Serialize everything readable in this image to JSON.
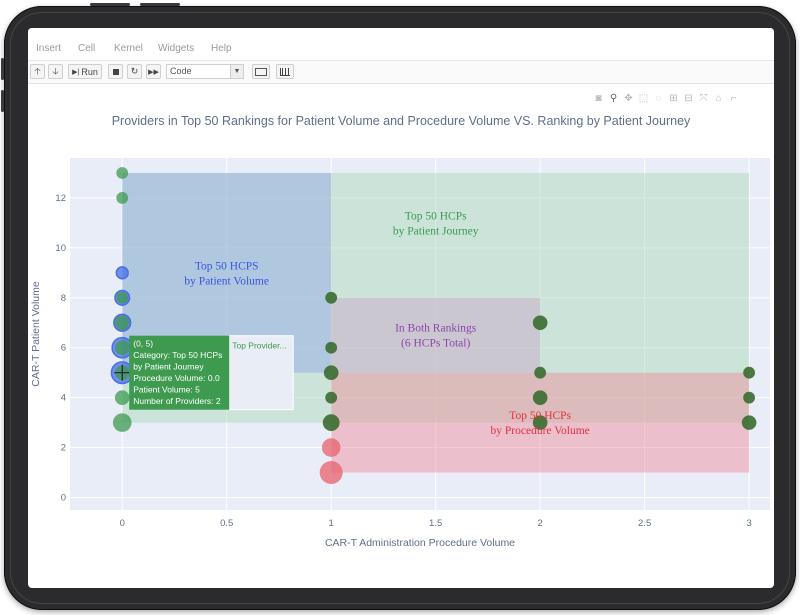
{
  "menu": {
    "items": [
      "Insert",
      "Cell",
      "Kernel",
      "Widgets",
      "Help"
    ]
  },
  "toolbar": {
    "run_label": "Run",
    "cell_type": "Code"
  },
  "modebar": {
    "icons": [
      "camera-icon",
      "zoom-icon",
      "pan-icon",
      "box-select-icon",
      "lasso-icon",
      "zoom-in-icon",
      "zoom-out-icon",
      "autoscale-icon",
      "home-icon",
      "spike-icon"
    ]
  },
  "colors": {
    "plot_bg": "#e8edf7",
    "patient_volume": "#4a6de6",
    "patient_journey": "#3d9a4f",
    "procedure_volume": "#e8606e",
    "both": "#8e44ad",
    "both_marker": "#3a6b30"
  },
  "chart_data": {
    "type": "scatter",
    "title": "Providers in Top 50 Rankings for Patient Volume and Procedure Volume VS. Ranking by Patient Journey",
    "xlabel": "CAR-T Administration Procedure Volume",
    "ylabel": "CAR-T Patient Volume",
    "xlim": [
      -0.25,
      3.1
    ],
    "ylim": [
      -0.5,
      13.6
    ],
    "xticks": [
      0,
      0.5,
      1,
      1.5,
      2,
      2.5,
      3
    ],
    "xtick_labels": [
      "0",
      "0.5",
      "1",
      "1.5",
      "2",
      "2.5",
      "3"
    ],
    "yticks": [
      0,
      2,
      4,
      6,
      8,
      10,
      12
    ],
    "ytick_labels": [
      "0",
      "2",
      "4",
      "6",
      "8",
      "10",
      "12"
    ],
    "grid": true,
    "regions": [
      {
        "name": "Top 50 HCPs by Patient Journey",
        "label": [
          "Top 50 HCPs",
          "by Patient Journey"
        ],
        "x0": 0,
        "x1": 3,
        "y0": 3,
        "y1": 13,
        "color": "#a8d8b4",
        "text_color": "#3d9a4f",
        "label_x": 1.5,
        "label_y": 11.0
      },
      {
        "name": "Top 50 HCPS by Patient Volume",
        "label": [
          "Top 50 HCPS",
          "by Patient Volume"
        ],
        "x0": 0,
        "x1": 1,
        "y0": 5,
        "y1": 13,
        "color": "#8ea4e6",
        "text_color": "#3b55e0",
        "label_x": 0.5,
        "label_y": 9.0
      },
      {
        "name": "Top 50 HCPs by Procedure Volume",
        "label": [
          "Top 50 HCPs",
          "by Procedure Volume"
        ],
        "x0": 1,
        "x1": 3,
        "y0": 1,
        "y1": 5,
        "color": "#f08a96",
        "text_color": "#e8303f",
        "label_x": 2.0,
        "label_y": 3.0
      },
      {
        "name": "In Both Rankings (6 HCPs Total)",
        "label": [
          "In Both Rankings",
          "(6 HCPs Total)"
        ],
        "x0": 1,
        "x1": 2,
        "y0": 5,
        "y1": 8,
        "color": "#c9a3c8",
        "text_color": "#8e44ad",
        "label_x": 1.5,
        "label_y": 6.5
      }
    ],
    "series": [
      {
        "name": "Top 50 HCPS by Patient Volume",
        "color": "#4a6de6",
        "points": [
          {
            "x": 0,
            "y": 9,
            "n": 1
          },
          {
            "x": 0,
            "y": 8,
            "n": 2
          },
          {
            "x": 0,
            "y": 7,
            "n": 3
          },
          {
            "x": 0,
            "y": 6,
            "n": 5
          },
          {
            "x": 0,
            "y": 5,
            "n": 6
          }
        ]
      },
      {
        "name": "Top 50 HCPs by Patient Journey",
        "color": "#3d9a4f",
        "points": [
          {
            "x": 0,
            "y": 13,
            "n": 1
          },
          {
            "x": 0,
            "y": 12,
            "n": 1
          },
          {
            "x": 0,
            "y": 8,
            "n": 1
          },
          {
            "x": 0,
            "y": 7,
            "n": 2
          },
          {
            "x": 0,
            "y": 6,
            "n": 2
          },
          {
            "x": 0,
            "y": 5,
            "n": 2
          },
          {
            "x": 0,
            "y": 4,
            "n": 2
          },
          {
            "x": 0,
            "y": 3,
            "n": 4
          },
          {
            "x": 1,
            "y": 8,
            "n": 1
          },
          {
            "x": 1,
            "y": 6,
            "n": 1
          },
          {
            "x": 1,
            "y": 5,
            "n": 2
          },
          {
            "x": 1,
            "y": 4,
            "n": 1
          },
          {
            "x": 1,
            "y": 3,
            "n": 3
          },
          {
            "x": 2,
            "y": 7,
            "n": 2
          },
          {
            "x": 2,
            "y": 5,
            "n": 1
          },
          {
            "x": 2,
            "y": 4,
            "n": 2
          },
          {
            "x": 2,
            "y": 3,
            "n": 2
          },
          {
            "x": 3,
            "y": 5,
            "n": 1
          },
          {
            "x": 3,
            "y": 4,
            "n": 1
          },
          {
            "x": 3,
            "y": 3,
            "n": 2
          }
        ]
      },
      {
        "name": "Top 50 HCPs by Procedure Volume",
        "color": "#e8606e",
        "points": [
          {
            "x": 1,
            "y": 2,
            "n": 4
          },
          {
            "x": 1,
            "y": 1,
            "n": 7
          }
        ]
      }
    ],
    "tooltip": {
      "at_x": 0,
      "at_y": 5,
      "color": "#3d9a4f",
      "lines": [
        "(0, 5)",
        "Category: Top 50 HCPs",
        "by Patient Journey",
        "Procedure Volume: 0.0",
        "Patient Volume: 5",
        "Number of Providers: 2"
      ],
      "secondary_label": "Top Provider..."
    }
  }
}
